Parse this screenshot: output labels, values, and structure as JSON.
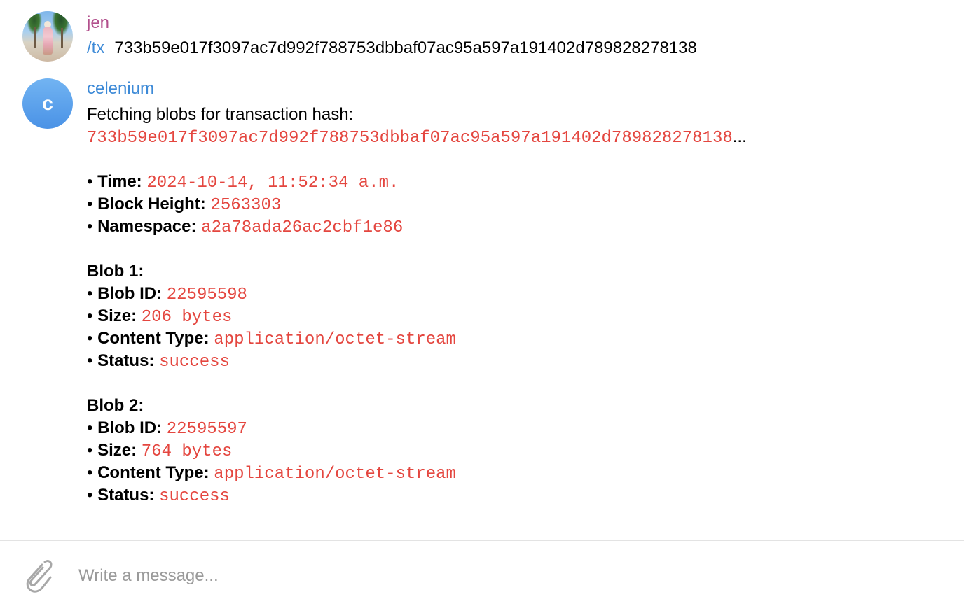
{
  "messages": {
    "jen": {
      "sender": "jen",
      "command": "/tx",
      "text": "733b59e017f3097ac7d992f788753dbbaf07ac95a597a191402d789828278138"
    },
    "bot": {
      "sender": "celenium",
      "avatar_letter": "c",
      "intro": "Fetching blobs for transaction hash:",
      "hash": "733b59e017f3097ac7d992f788753dbbaf07ac95a597a191402d789828278138",
      "hash_suffix": "...",
      "bullet": "• ",
      "time_label": "Time:",
      "time_value": "2024-10-14, 11:52:34 a.m.",
      "height_label": "Block Height:",
      "height_value": "2563303",
      "namespace_label": "Namespace:",
      "namespace_value": "a2a78ada26ac2cbf1e86",
      "blobs": [
        {
          "title": "Blob 1:",
          "id_label": "Blob ID:",
          "id_value": "22595598",
          "size_label": "Size:",
          "size_value": "206 bytes",
          "type_label": "Content Type:",
          "type_value": "application/octet-stream",
          "status_label": "Status:",
          "status_value": "success"
        },
        {
          "title": "Blob 2:",
          "id_label": "Blob ID:",
          "id_value": "22595597",
          "size_label": "Size:",
          "size_value": "764 bytes",
          "type_label": "Content Type:",
          "type_value": "application/octet-stream",
          "status_label": "Status:",
          "status_value": "success"
        }
      ]
    }
  },
  "composer": {
    "placeholder": "Write a message...",
    "attach_icon": "paperclip-icon"
  },
  "colors": {
    "jen_name": "#b24f8c",
    "bot_name": "#3d8ad7",
    "code": "#e4463f",
    "avatar_blue": "#4a92e6"
  }
}
